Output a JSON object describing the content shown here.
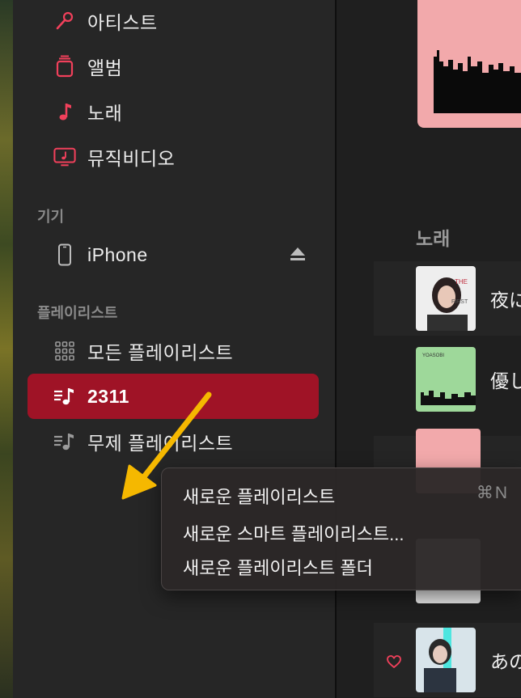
{
  "sidebar": {
    "library_items": [
      {
        "label": "아티스트",
        "icon": "microphone-icon"
      },
      {
        "label": "앨범",
        "icon": "album-icon"
      },
      {
        "label": "노래",
        "icon": "music-note-icon"
      },
      {
        "label": "뮤직비디오",
        "icon": "music-video-icon"
      }
    ],
    "devices_header": "기기",
    "device": {
      "label": "iPhone",
      "icon": "iphone-icon"
    },
    "playlists_header": "플레이리스트",
    "playlists": [
      {
        "label": "모든 플레이리스트",
        "icon": "grid-icon"
      },
      {
        "label": "2311",
        "icon": "playlist-icon",
        "selected": true
      },
      {
        "label": "무제 플레이리스트",
        "icon": "playlist-icon"
      }
    ]
  },
  "main": {
    "songs_heading": "노래",
    "songs": [
      {
        "title": "夜に"
      },
      {
        "title": "優し"
      },
      {
        "title": ""
      },
      {
        "title": ""
      },
      {
        "title": "あの"
      }
    ]
  },
  "context_menu": {
    "items": [
      {
        "label": "새로운 플레이리스트",
        "shortcut": "⌘N"
      },
      {
        "label": "새로운 스마트 플레이리스트..."
      },
      {
        "label": "새로운 플레이리스트 폴더"
      }
    ]
  },
  "colors": {
    "accent": "#f1405b",
    "selected_bg": "#9f1326",
    "arrow": "#f5b800"
  }
}
